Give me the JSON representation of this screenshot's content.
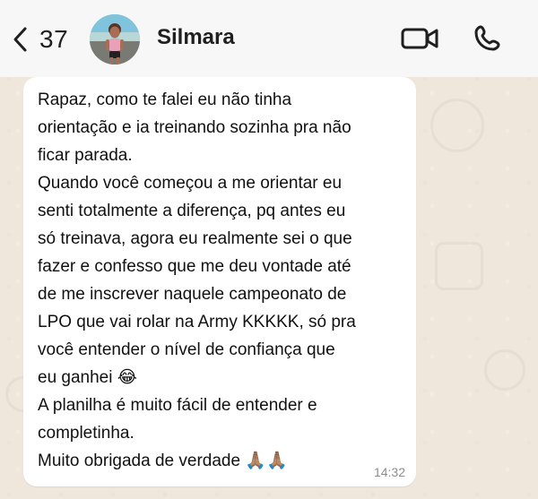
{
  "header": {
    "unread_count": "37",
    "contact_name": "Silmara",
    "icons": {
      "back": "chevron-left-icon",
      "video": "video-camera-icon",
      "call": "phone-icon"
    }
  },
  "message": {
    "text": "Rapaz, como te falei eu não tinha\norientação e ia treinando sozinha pra não\nficar parada.\nQuando você começou a me orientar eu\nsenti totalmente a diferença, pq antes eu\nsó treinava, agora eu realmente sei o que\nfazer e confesso que me deu vontade até\nde me inscrever naquele campeonato de\nLPO que vai rolar na Army KKKKK, só pra\nvocê entender o nível de confiança que\neu ganhei 😂\nA planilha é muito fácil de entender e\ncompletinha.\nMuito obrigada de verdade 🙏🏽🙏🏽",
    "time": "14:32"
  },
  "colors": {
    "chat_background": "#efe7dc",
    "header_background": "#f7f7f7",
    "bubble_background": "#ffffff",
    "text": "#111111",
    "timestamp": "#8d8d8d"
  }
}
